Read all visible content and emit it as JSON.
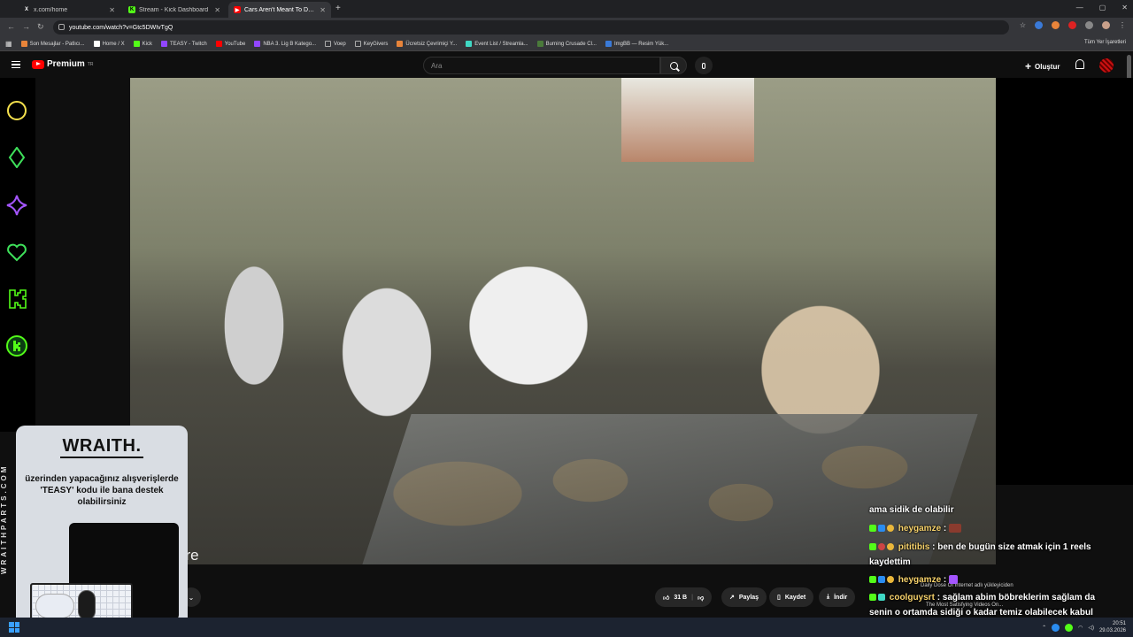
{
  "browser": {
    "tabs": [
      {
        "title": "x.com/home",
        "icon": "x-icon",
        "color": "#ffffff",
        "glyph": "X"
      },
      {
        "title": "Stream - Kick Dashboard",
        "icon": "kick-icon",
        "color": "#53fc18",
        "glyph": "K"
      },
      {
        "title": "Cars Aren't Meant To Do That",
        "icon": "youtube-icon",
        "color": "#ff0000",
        "glyph": "▶"
      }
    ],
    "url": "youtube.com/watch?v=Gtc5DWIvTgQ",
    "bookmarks": [
      {
        "label": "Son Mesajlar - Patlıcı...",
        "color": "#e8843a"
      },
      {
        "label": "Home / X",
        "color": "#ffffff"
      },
      {
        "label": "Kick",
        "color": "#53fc18"
      },
      {
        "label": "TEASY - Twitch",
        "color": "#9146ff"
      },
      {
        "label": "YouTube",
        "color": "#ff0000"
      },
      {
        "label": "NBA 3. Lig B Katego...",
        "color": "#9146ff"
      },
      {
        "label": "Voep",
        "color": "#777777"
      },
      {
        "label": "KeyGivers",
        "color": "#777777"
      },
      {
        "label": "Ücretsiz Çevrimiçi Y...",
        "color": "#e8843a"
      },
      {
        "label": "Event List / Streamla...",
        "color": "#3fd8c4"
      },
      {
        "label": "Burning Crusade Cl...",
        "color": "#4a7a3a"
      },
      {
        "label": "ImgBB — Resim Yük...",
        "color": "#3a7ad8"
      }
    ],
    "bookmarks_right": "Tüm Yer İşaretleri"
  },
  "youtube": {
    "logo_text": "Premium",
    "logo_sup": "TR",
    "search_placeholder": "Ara",
    "create_label": "Oluştur"
  },
  "video": {
    "caption": "are"
  },
  "actions": {
    "like_count": "31 B",
    "share_label": "Paylaş",
    "save_label": "Kaydet",
    "download_label": "İndir"
  },
  "overlay_next": {
    "channel": "Daily Dose Of Internet adlı yükleyiciden",
    "title": "The Most Satisfying Videos On..."
  },
  "chat": {
    "partial_top": "ama sidik de olabilir",
    "messages": [
      {
        "user": "heygamze",
        "text": ":"
      },
      {
        "user": "pititibis",
        "text": ": ben de bugün size atmak için 1 reels kaydettim"
      },
      {
        "user": "heygamze",
        "text": ":"
      },
      {
        "user": "coolguysrt",
        "text": ": sağlam abim böbreklerim sağlam da senin o ortamda sidiği o kadar temiz olabilecek kabul etmen müthiş"
      }
    ]
  },
  "sponsor": {
    "brand": "WRAITH.",
    "text": "üzerinden yapacağınız alışverişlerde 'TEASY' kodu ile bana destek olabilirsiniz",
    "side_text": "WRAITHPARTS.COM"
  },
  "taskbar": {
    "time": "20:51",
    "date": "29.03.2026"
  }
}
